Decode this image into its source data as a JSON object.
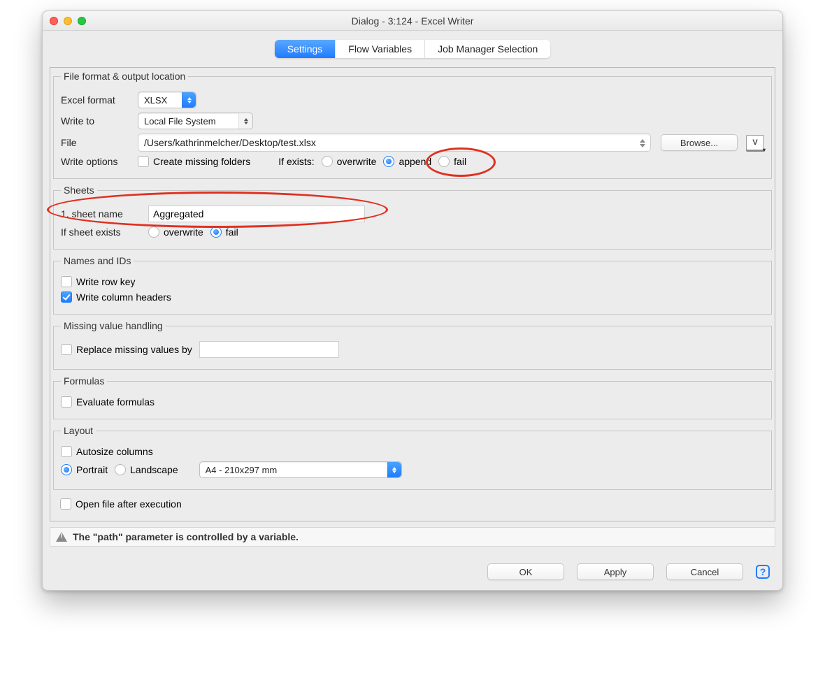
{
  "window": {
    "title": "Dialog - 3:124 - Excel Writer"
  },
  "tabs": {
    "settings": "Settings",
    "flow_vars": "Flow Variables",
    "job_mgr": "Job Manager Selection"
  },
  "group1": {
    "legend": "File format & output location",
    "excel_format_label": "Excel format",
    "excel_format_value": "XLSX",
    "write_to_label": "Write to",
    "write_to_value": "Local File System",
    "file_label": "File",
    "file_value": "/Users/kathrinmelcher/Desktop/test.xlsx",
    "browse": "Browse...",
    "write_options_label": "Write options",
    "create_missing": "Create missing folders",
    "if_exists_label": "If exists:",
    "overwrite": "overwrite",
    "append": "append",
    "fail": "fail"
  },
  "group2": {
    "legend": "Sheets",
    "sheet_name_label": "1. sheet name",
    "sheet_name_value": "Aggregated",
    "if_sheet_exists_label": "If sheet exists",
    "overwrite": "overwrite",
    "fail": "fail"
  },
  "group3": {
    "legend": "Names and IDs",
    "write_row_key": "Write row key",
    "write_col_headers": "Write column headers"
  },
  "group4": {
    "legend": "Missing value handling",
    "replace_missing": "Replace missing values by",
    "replace_value": ""
  },
  "group5": {
    "legend": "Formulas",
    "evaluate": "Evaluate formulas"
  },
  "group6": {
    "legend": "Layout",
    "autosize": "Autosize columns",
    "portrait": "Portrait",
    "landscape": "Landscape",
    "paper_value": "A4 - 210x297 mm"
  },
  "open_after": "Open file after execution",
  "status_msg": "The \"path\" parameter is controlled by a variable.",
  "buttons": {
    "ok": "OK",
    "apply": "Apply",
    "cancel": "Cancel"
  },
  "var_letter": "V"
}
